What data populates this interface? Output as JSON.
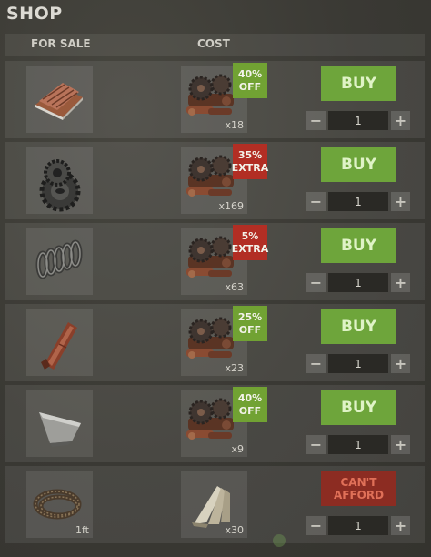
{
  "title": "SHOP",
  "header": {
    "for_sale": "FOR SALE",
    "cost": "COST"
  },
  "colors": {
    "buy_green": "#6ea53b",
    "offer_green": "#71a233",
    "extra_red": "#b22e24",
    "cant_afford_red": "#8c2c22"
  },
  "rows": [
    {
      "item_icon": "sheet-metal-icon",
      "item_qty": "",
      "cost_icon": "metal-fragments-icon",
      "cost_qty": "x18",
      "badge": {
        "line1": "40%",
        "line2": "OFF",
        "tone": "green"
      },
      "action": "BUY",
      "quantity": "1"
    },
    {
      "item_icon": "gears-icon",
      "item_qty": "",
      "cost_icon": "metal-fragments-icon",
      "cost_qty": "x169",
      "badge": {
        "line1": "35%",
        "line2": "EXTRA",
        "tone": "red"
      },
      "action": "BUY",
      "quantity": "1"
    },
    {
      "item_icon": "metal-spring-icon",
      "item_qty": "",
      "cost_icon": "metal-fragments-icon",
      "cost_qty": "x63",
      "badge": {
        "line1": "5%",
        "line2": "EXTRA",
        "tone": "red"
      },
      "action": "BUY",
      "quantity": "1"
    },
    {
      "item_icon": "metal-pipe-icon",
      "item_qty": "",
      "cost_icon": "metal-fragments-icon",
      "cost_qty": "x23",
      "badge": {
        "line1": "25%",
        "line2": "OFF",
        "tone": "green"
      },
      "action": "BUY",
      "quantity": "1"
    },
    {
      "item_icon": "metal-blade-icon",
      "item_qty": "",
      "cost_icon": "metal-fragments-icon",
      "cost_qty": "x9",
      "badge": {
        "line1": "40%",
        "line2": "OFF",
        "tone": "green"
      },
      "action": "BUY",
      "quantity": "1"
    },
    {
      "item_icon": "rope-icon",
      "item_qty": "1ft",
      "cost_icon": "bone-fragments-icon",
      "cost_qty": "x30",
      "badge": null,
      "action": "CAN'T AFFORD",
      "action_line1": "CAN'T",
      "action_line2": "AFFORD",
      "quantity": "1"
    }
  ],
  "stepper": {
    "minus": "−",
    "plus": "+"
  }
}
